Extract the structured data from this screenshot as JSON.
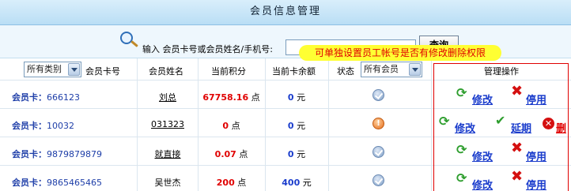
{
  "title": "会员信息管理",
  "search": {
    "label": "输入 会员卡号或会员姓名/手机号:",
    "value": "",
    "button": "查询"
  },
  "tooltip": "可单独设置员工帐号是否有修改删除权限",
  "filters": {
    "category": "所有类别",
    "status": "所有会员"
  },
  "columns": {
    "card": "会员卡号",
    "name": "会员姓名",
    "points": "当前积分",
    "balance": "当前卡余额",
    "status": "状态",
    "actions": "管理操作"
  },
  "labels": {
    "card_prefix": "会员卡：",
    "points_unit": "点",
    "balance_unit": "元"
  },
  "rows": [
    {
      "card": "666123",
      "name": "刘总",
      "points": "67758.16",
      "balance": "0",
      "status": "ok"
    },
    {
      "card": "10032",
      "name": "031323",
      "points": "0",
      "balance": "0",
      "status": "warn"
    },
    {
      "card": "9879879879",
      "name": "就直接",
      "points": "0.07",
      "balance": "0",
      "status": "ok"
    },
    {
      "card": "9865465465",
      "name": "吴世杰",
      "points": "200",
      "balance": "400",
      "status": "ok"
    }
  ],
  "actions": {
    "edit": "修改",
    "disable": "停用",
    "extend": "延期",
    "delete": "删"
  },
  "icons": {
    "status_ok": "check-circle-icon",
    "status_warn": "warning-circle-icon",
    "edit": "refresh-arrows-icon",
    "disable": "red-x-icon",
    "extend": "green-check-icon",
    "delete": "delete-circle-icon"
  },
  "colors": {
    "header_bg": "#c7e6f8",
    "points": "#e00000",
    "balance": "#1a3ccc",
    "link": "#1a3ccc",
    "tooltip_bg": "#ffff33",
    "tooltip_text": "#e00000",
    "highlight_box": "#e00000"
  }
}
